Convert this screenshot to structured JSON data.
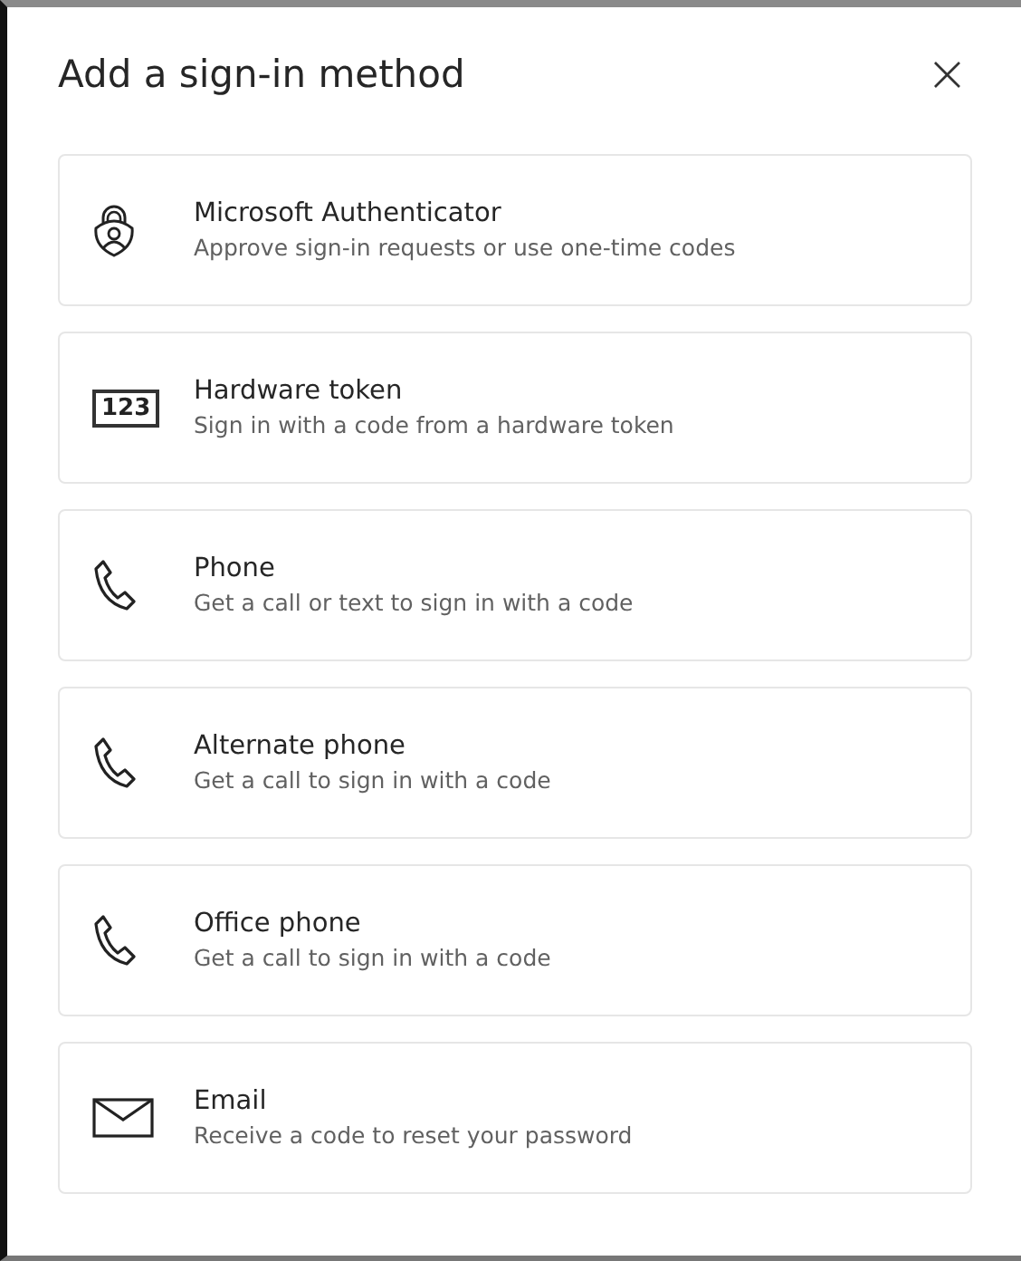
{
  "dialog": {
    "title": "Add a sign-in method",
    "close": "×"
  },
  "methods": [
    {
      "kind": "authenticator",
      "name": "Microsoft Authenticator",
      "description": "Approve sign-in requests or use one-time codes"
    },
    {
      "kind": "token",
      "icon_text": "123",
      "name": "Hardware token",
      "description": "Sign in with a code from a hardware token"
    },
    {
      "kind": "phone",
      "name": "Phone",
      "description": "Get a call or text to sign in with a code"
    },
    {
      "kind": "phone",
      "name": "Alternate phone",
      "description": "Get a call to sign in with a code"
    },
    {
      "kind": "phone",
      "name": "Office phone",
      "description": "Get a call to sign in with a code"
    },
    {
      "kind": "email",
      "name": "Email",
      "description": "Receive a code to reset your password"
    }
  ]
}
